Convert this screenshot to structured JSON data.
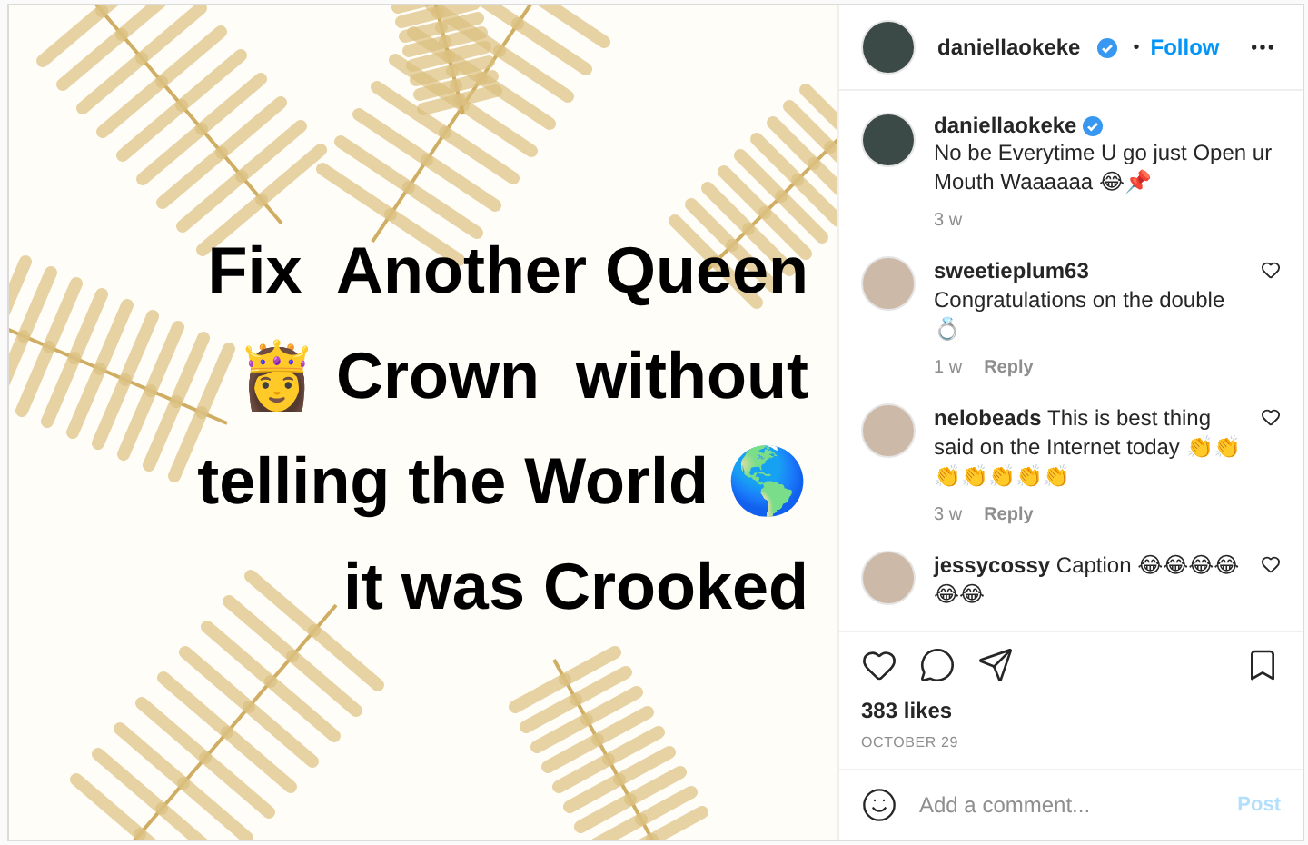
{
  "post_image": {
    "lines": [
      "Fix  Another Queen",
      "👸 Crown  without",
      "telling the World 🌎",
      "it was Crooked"
    ]
  },
  "header": {
    "username": "daniellaokeke",
    "verified": true,
    "separator": "•",
    "follow": "Follow"
  },
  "caption": {
    "username": "daniellaokeke",
    "verified": true,
    "text": "No be Everytime U go just Open ur Mouth Waaaaaa 😂📌",
    "time": "3 w"
  },
  "comments": [
    {
      "username": "sweetieplum63",
      "text": "Congratulations on the double 💍",
      "time": "1 w",
      "reply": "Reply",
      "liked": false
    },
    {
      "username": "nelobeads",
      "text": "This is best thing said on the Internet today 👏👏👏👏👏👏👏",
      "time": "3 w",
      "reply": "Reply",
      "liked": false
    },
    {
      "username": "jessycossy",
      "text": "Caption 😂😂😂😂😂😂",
      "liked": false
    }
  ],
  "likes": "383 likes",
  "date": "OCTOBER 29",
  "comment_box": {
    "placeholder": "Add a comment...",
    "post": "Post",
    "disabled": true
  }
}
